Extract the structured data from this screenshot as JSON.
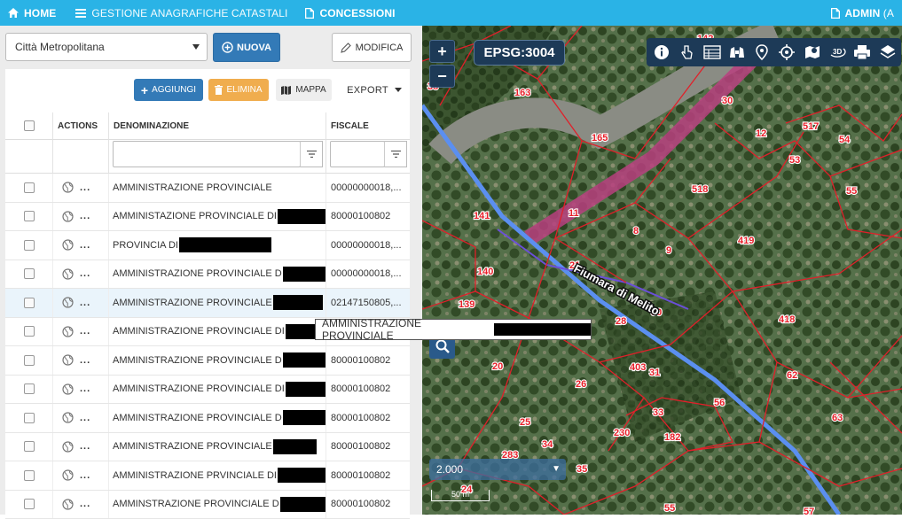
{
  "nav": {
    "home": "HOME",
    "gestione": "GESTIONE",
    "anagrafiche": "ANAGRAFICHE",
    "catastali": "CATASTALI",
    "concessioni": "CONCESSIONI",
    "admin": "ADMIN",
    "admin_suffix": "(A"
  },
  "selector": {
    "value": "Città Metropolitana"
  },
  "buttons": {
    "nuova": "NUOVA",
    "modifica": "MODIFICA",
    "aggiungi": "AGGIUNGI",
    "elimina": "ELIMINA",
    "mappa": "MAPPA",
    "export": "EXPORT"
  },
  "table": {
    "headers": {
      "actions": "ACTIONS",
      "denominazione": "DENOMINAZIONE",
      "fiscale": "FISCALE"
    },
    "rows": [
      {
        "name": "AMMINISTRAZIONE PROVINCIALE",
        "fiscale": "00000000018,..."
      },
      {
        "name": "AMMINISTAZIONE PROVINCIALE DI",
        "fiscale": "80000100802"
      },
      {
        "name": "PROVINCIA DI",
        "fiscale": "00000000018,..."
      },
      {
        "name": "AMMINISTRAZIONE PROVINCIALE D",
        "fiscale": "00000000018,..."
      },
      {
        "name": "AMMINISTRAZIONE PROVINCIALE",
        "fiscale": "02147150805,..."
      },
      {
        "name": "AMMINISTRAZIONE PROVINCIALE DI",
        "fiscale": "80000100802"
      },
      {
        "name": "AMMINISTRAZIONE PROVINCIALE D",
        "fiscale": "80000100802"
      },
      {
        "name": "AMMINISTRAZIONE PROVINCIALE DI",
        "fiscale": "80000100802"
      },
      {
        "name": "AMMINISTRAZIONE PROVINCIALE D",
        "fiscale": "80000100802"
      },
      {
        "name": "AMMINISTRAZIONE PROVINCIALE",
        "fiscale": "80000100802"
      },
      {
        "name": "AMMINISTRAZIONE PRVINCIALE DI",
        "fiscale": "80000100802"
      },
      {
        "name": "AMMINSTRAZIONE PROVINCIALE D",
        "fiscale": "80000100802"
      }
    ],
    "row_action_dots": "..."
  },
  "tooltip": {
    "text": "AMMINISTRAZIONE PROVINCIALE"
  },
  "map": {
    "epsg": "EPSG:3004",
    "zoom_in": "+",
    "zoom_out": "−",
    "scale_value": "2.000",
    "scalebar_label": "50 m",
    "river_label": "Fiumara di Melito",
    "parcels": [
      "38",
      "163",
      "30",
      "165",
      "12",
      "517",
      "54",
      "53",
      "55",
      "518",
      "11",
      "141",
      "8",
      "419",
      "9",
      "140",
      "21",
      "139",
      "28",
      "30",
      "418",
      "20",
      "403",
      "31",
      "62",
      "26",
      "56",
      "33",
      "63",
      "25",
      "230",
      "182",
      "34",
      "283",
      "35",
      "24",
      "55",
      "57",
      "142"
    ],
    "tools": [
      "info-icon",
      "hand-pointer-icon",
      "table-icon",
      "binoculars-icon",
      "marker-icon",
      "crosshair-icon",
      "map-pin-icon",
      "3d-icon",
      "print-icon",
      "layers-icon"
    ]
  },
  "colors": {
    "accent": "#2ab3e6",
    "primary": "#337ab7",
    "warning": "#f0ad4e",
    "parcel": "#e0202a",
    "road": "#5b8ff0"
  }
}
